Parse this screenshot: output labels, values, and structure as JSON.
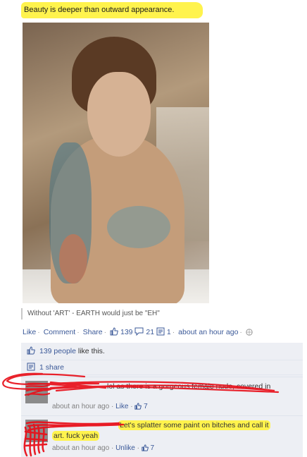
{
  "post": {
    "message": "Beauty is deeper than outward appearance.",
    "caption": "Without 'ART' - EARTH would just be \"EH\""
  },
  "actions": {
    "like": "Like",
    "comment": "Comment",
    "share": "Share",
    "likes_count": "139",
    "comments_count": "21",
    "shares_count": "1",
    "time": "about an hour ago"
  },
  "feedback": {
    "likes_count_text": "139 people",
    "likes_suffix": "like this.",
    "shares_text": "1 share"
  },
  "comments": [
    {
      "body": "lol as there is a gorgeous female nude, covered in",
      "time": "about an hour ago",
      "like_label": "Like",
      "likes": "7"
    },
    {
      "body": "Let's splatter some paint on bitches and call it",
      "body2": "art. fuck yeah",
      "time": "about an hour ago",
      "like_label": "Unlike",
      "likes": "7"
    }
  ],
  "colors": {
    "highlight": "#fff34d",
    "scribble": "#e8101a",
    "link": "#3b5998",
    "feedback_bg": "#edeff4"
  }
}
